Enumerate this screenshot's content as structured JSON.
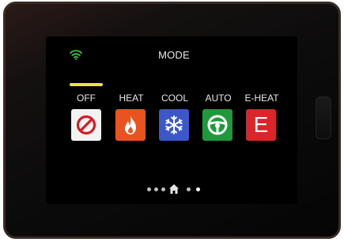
{
  "screen": {
    "title": "MODE",
    "wifi": {
      "icon": "wifi-icon",
      "color": "#3ec43e"
    }
  },
  "modes": [
    {
      "label": "OFF",
      "icon": "prohibited-icon",
      "color": "#f2f2f2",
      "selected": true
    },
    {
      "label": "HEAT",
      "icon": "flame-icon",
      "color": "#e8531f",
      "selected": false
    },
    {
      "label": "COOL",
      "icon": "snowflake-icon",
      "color": "#3b57c9",
      "selected": false
    },
    {
      "label": "AUTO",
      "icon": "steering-wheel-icon",
      "color": "#1f9a3a",
      "selected": false
    },
    {
      "label": "E-HEAT",
      "icon": "letter-e-icon",
      "glyph": "E",
      "color": "#d9262b",
      "selected": false
    }
  ],
  "selection_indicator_color": "#e9e43a",
  "pagination": {
    "icon": "home-icon",
    "dot_color": "#bdbdbd",
    "active_dot_color": "#ffffff"
  }
}
